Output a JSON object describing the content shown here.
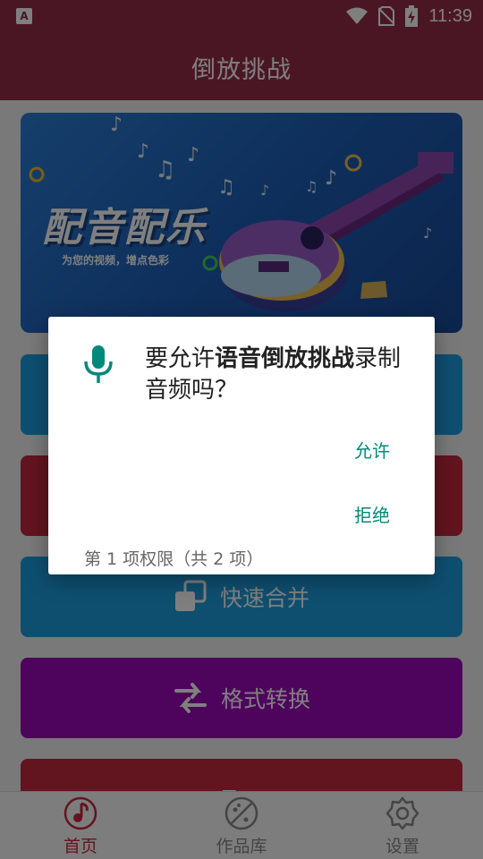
{
  "status_bar": {
    "left_icon": "A",
    "time": "11:39",
    "icons": [
      "wifi-icon",
      "no-sim-icon",
      "battery-charging-icon"
    ]
  },
  "app": {
    "title": "倒放挑战"
  },
  "banner": {
    "title": "配音配乐",
    "subtitle": "为您的视频，增点色彩"
  },
  "features": [
    {
      "label": "",
      "icon": "reverse-icon"
    },
    {
      "label": "",
      "icon": "music-icon"
    },
    {
      "label": "快速合并",
      "icon": "merge-icon"
    },
    {
      "label": "格式转换",
      "icon": "swap-icon"
    },
    {
      "label": "",
      "icon": "export-icon"
    }
  ],
  "nav": [
    {
      "label": "首页",
      "icon": "music-note-icon",
      "active": true
    },
    {
      "label": "作品库",
      "icon": "palette-icon",
      "active": false
    },
    {
      "label": "设置",
      "icon": "gear-icon",
      "active": false
    }
  ],
  "dialog": {
    "msg_prefix": "要允许",
    "app_name": "语音倒放挑战",
    "msg_suffix": "录制音频吗？",
    "allow_label": "允许",
    "deny_label": "拒绝",
    "counter": "第 1 项权限（共 2 项）"
  },
  "colors": {
    "primary": "#962c49",
    "accent": "#00897b",
    "active_nav": "#c8283f"
  }
}
